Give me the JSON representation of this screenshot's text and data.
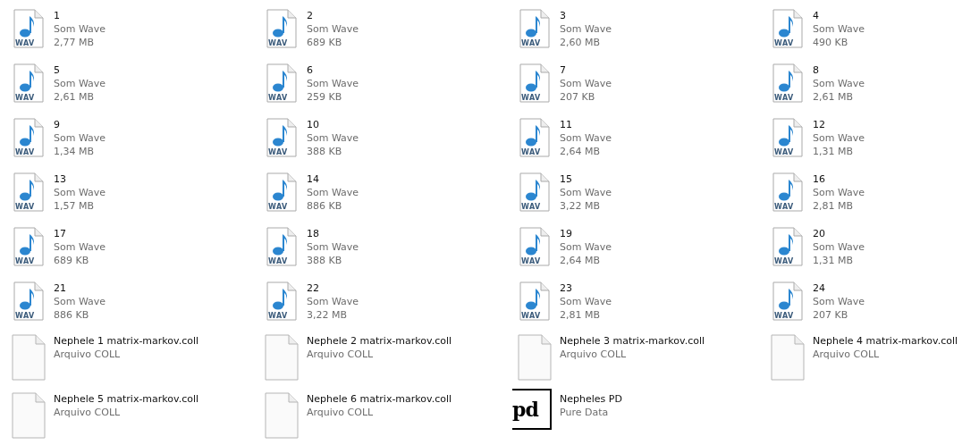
{
  "files": [
    {
      "kind": "wav",
      "name": "1",
      "type": "Som Wave",
      "size": "2,77 MB",
      "icon_text": "WAV"
    },
    {
      "kind": "wav",
      "name": "2",
      "type": "Som Wave",
      "size": "689 KB",
      "icon_text": "WAV"
    },
    {
      "kind": "wav",
      "name": "3",
      "type": "Som Wave",
      "size": "2,60 MB",
      "icon_text": "WAV"
    },
    {
      "kind": "wav",
      "name": "4",
      "type": "Som Wave",
      "size": "490 KB",
      "icon_text": "WAV"
    },
    {
      "kind": "wav",
      "name": "5",
      "type": "Som Wave",
      "size": "2,61 MB",
      "icon_text": "WAV"
    },
    {
      "kind": "wav",
      "name": "6",
      "type": "Som Wave",
      "size": "259 KB",
      "icon_text": "WAV"
    },
    {
      "kind": "wav",
      "name": "7",
      "type": "Som Wave",
      "size": "207 KB",
      "icon_text": "WAV"
    },
    {
      "kind": "wav",
      "name": "8",
      "type": "Som Wave",
      "size": "2,61 MB",
      "icon_text": "WAV"
    },
    {
      "kind": "wav",
      "name": "9",
      "type": "Som Wave",
      "size": "1,34 MB",
      "icon_text": "WAV"
    },
    {
      "kind": "wav",
      "name": "10",
      "type": "Som Wave",
      "size": "388 KB",
      "icon_text": "WAV"
    },
    {
      "kind": "wav",
      "name": "11",
      "type": "Som Wave",
      "size": "2,64 MB",
      "icon_text": "WAV"
    },
    {
      "kind": "wav",
      "name": "12",
      "type": "Som Wave",
      "size": "1,31 MB",
      "icon_text": "WAV"
    },
    {
      "kind": "wav",
      "name": "13",
      "type": "Som Wave",
      "size": "1,57 MB",
      "icon_text": "WAV"
    },
    {
      "kind": "wav",
      "name": "14",
      "type": "Som Wave",
      "size": "886 KB",
      "icon_text": "WAV"
    },
    {
      "kind": "wav",
      "name": "15",
      "type": "Som Wave",
      "size": "3,22 MB",
      "icon_text": "WAV"
    },
    {
      "kind": "wav",
      "name": "16",
      "type": "Som Wave",
      "size": "2,81 MB",
      "icon_text": "WAV"
    },
    {
      "kind": "wav",
      "name": "17",
      "type": "Som Wave",
      "size": "689 KB",
      "icon_text": "WAV"
    },
    {
      "kind": "wav",
      "name": "18",
      "type": "Som Wave",
      "size": "388 KB",
      "icon_text": "WAV"
    },
    {
      "kind": "wav",
      "name": "19",
      "type": "Som Wave",
      "size": "2,64 MB",
      "icon_text": "WAV"
    },
    {
      "kind": "wav",
      "name": "20",
      "type": "Som Wave",
      "size": "1,31 MB",
      "icon_text": "WAV"
    },
    {
      "kind": "wav",
      "name": "21",
      "type": "Som Wave",
      "size": "886 KB",
      "icon_text": "WAV"
    },
    {
      "kind": "wav",
      "name": "22",
      "type": "Som Wave",
      "size": "3,22 MB",
      "icon_text": "WAV"
    },
    {
      "kind": "wav",
      "name": "23",
      "type": "Som Wave",
      "size": "2,81 MB",
      "icon_text": "WAV"
    },
    {
      "kind": "wav",
      "name": "24",
      "type": "Som Wave",
      "size": "207 KB",
      "icon_text": "WAV"
    },
    {
      "kind": "blank",
      "name": "Nephele 1 matrix-markov.coll",
      "type": "Arquivo COLL"
    },
    {
      "kind": "blank",
      "name": "Nephele 2 matrix-markov.coll",
      "type": "Arquivo COLL"
    },
    {
      "kind": "blank",
      "name": "Nephele 3 matrix-markov.coll",
      "type": "Arquivo COLL"
    },
    {
      "kind": "blank",
      "name": "Nephele 4 matrix-markov.coll",
      "type": "Arquivo COLL"
    },
    {
      "kind": "blank",
      "name": "Nephele 5 matrix-markov.coll",
      "type": "Arquivo COLL"
    },
    {
      "kind": "blank",
      "name": "Nephele 6 matrix-markov.coll",
      "type": "Arquivo COLL"
    },
    {
      "kind": "pd",
      "name": "Nepheles PD",
      "type": "Pure Data",
      "icon_text": "pd"
    }
  ]
}
